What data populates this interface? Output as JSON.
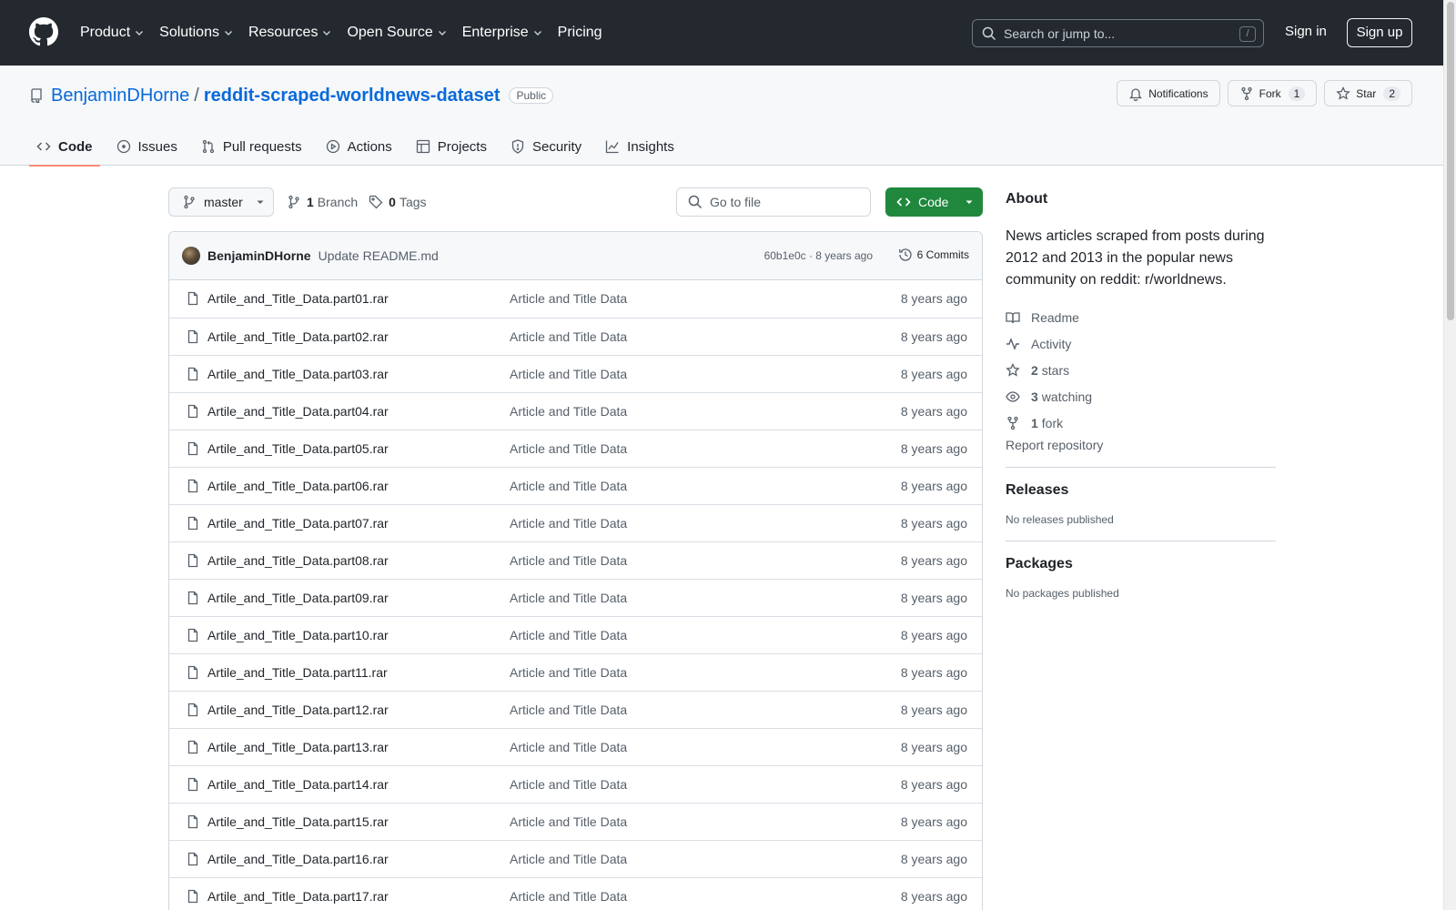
{
  "header": {
    "nav": [
      {
        "label": "Product",
        "dropdown": true
      },
      {
        "label": "Solutions",
        "dropdown": true
      },
      {
        "label": "Resources",
        "dropdown": true
      },
      {
        "label": "Open Source",
        "dropdown": true
      },
      {
        "label": "Enterprise",
        "dropdown": true
      },
      {
        "label": "Pricing",
        "dropdown": false
      }
    ],
    "search_placeholder": "Search or jump to...",
    "search_shortcut": "/",
    "sign_in": "Sign in",
    "sign_up": "Sign up"
  },
  "repo": {
    "owner": "BenjaminDHorne",
    "separator": "/",
    "name": "reddit-scraped-worldnews-dataset",
    "visibility": "Public",
    "notifications_label": "Notifications",
    "fork_label": "Fork",
    "fork_count": "1",
    "star_label": "Star",
    "star_count": "2",
    "tabs": [
      {
        "label": "Code",
        "icon": "code-icon",
        "active": true
      },
      {
        "label": "Issues",
        "icon": "issue-icon",
        "active": false
      },
      {
        "label": "Pull requests",
        "icon": "pull-request-icon",
        "active": false
      },
      {
        "label": "Actions",
        "icon": "play-icon",
        "active": false
      },
      {
        "label": "Projects",
        "icon": "table-icon",
        "active": false
      },
      {
        "label": "Security",
        "icon": "shield-icon",
        "active": false
      },
      {
        "label": "Insights",
        "icon": "graph-icon",
        "active": false
      }
    ]
  },
  "toolbar": {
    "branch": "master",
    "branch_count": "1",
    "branch_label": "Branch",
    "tag_count": "0",
    "tag_label": "Tags",
    "goto_placeholder": "Go to file",
    "code_label": "Code"
  },
  "commit": {
    "author": "BenjaminDHorne",
    "message": "Update README.md",
    "meta": "60b1e0c · 8 years ago",
    "count_label": "6 Commits"
  },
  "files": [
    {
      "name": "Artile_and_Title_Data.part01.rar",
      "message": "Article and Title Data",
      "time": "8 years ago"
    },
    {
      "name": "Artile_and_Title_Data.part02.rar",
      "message": "Article and Title Data",
      "time": "8 years ago"
    },
    {
      "name": "Artile_and_Title_Data.part03.rar",
      "message": "Article and Title Data",
      "time": "8 years ago"
    },
    {
      "name": "Artile_and_Title_Data.part04.rar",
      "message": "Article and Title Data",
      "time": "8 years ago"
    },
    {
      "name": "Artile_and_Title_Data.part05.rar",
      "message": "Article and Title Data",
      "time": "8 years ago"
    },
    {
      "name": "Artile_and_Title_Data.part06.rar",
      "message": "Article and Title Data",
      "time": "8 years ago"
    },
    {
      "name": "Artile_and_Title_Data.part07.rar",
      "message": "Article and Title Data",
      "time": "8 years ago"
    },
    {
      "name": "Artile_and_Title_Data.part08.rar",
      "message": "Article and Title Data",
      "time": "8 years ago"
    },
    {
      "name": "Artile_and_Title_Data.part09.rar",
      "message": "Article and Title Data",
      "time": "8 years ago"
    },
    {
      "name": "Artile_and_Title_Data.part10.rar",
      "message": "Article and Title Data",
      "time": "8 years ago"
    },
    {
      "name": "Artile_and_Title_Data.part11.rar",
      "message": "Article and Title Data",
      "time": "8 years ago"
    },
    {
      "name": "Artile_and_Title_Data.part12.rar",
      "message": "Article and Title Data",
      "time": "8 years ago"
    },
    {
      "name": "Artile_and_Title_Data.part13.rar",
      "message": "Article and Title Data",
      "time": "8 years ago"
    },
    {
      "name": "Artile_and_Title_Data.part14.rar",
      "message": "Article and Title Data",
      "time": "8 years ago"
    },
    {
      "name": "Artile_and_Title_Data.part15.rar",
      "message": "Article and Title Data",
      "time": "8 years ago"
    },
    {
      "name": "Artile_and_Title_Data.part16.rar",
      "message": "Article and Title Data",
      "time": "8 years ago"
    },
    {
      "name": "Artile_and_Title_Data.part17.rar",
      "message": "Article and Title Data",
      "time": "8 years ago"
    }
  ],
  "about": {
    "heading": "About",
    "description": "News articles scraped from posts during 2012 and 2013 in the popular news community on reddit: r/worldnews.",
    "readme": "Readme",
    "activity": "Activity",
    "stars_count": "2",
    "stars_label": "stars",
    "watching_count": "3",
    "watching_label": "watching",
    "fork_count": "1",
    "fork_label": "fork",
    "report": "Report repository"
  },
  "releases": {
    "heading": "Releases",
    "empty": "No releases published"
  },
  "packages": {
    "heading": "Packages",
    "empty": "No packages published"
  },
  "colors": {
    "header_bg": "#24292f",
    "link": "#0969da",
    "code_button": "#1f883d",
    "active_tab_underline": "#fd8c73"
  }
}
